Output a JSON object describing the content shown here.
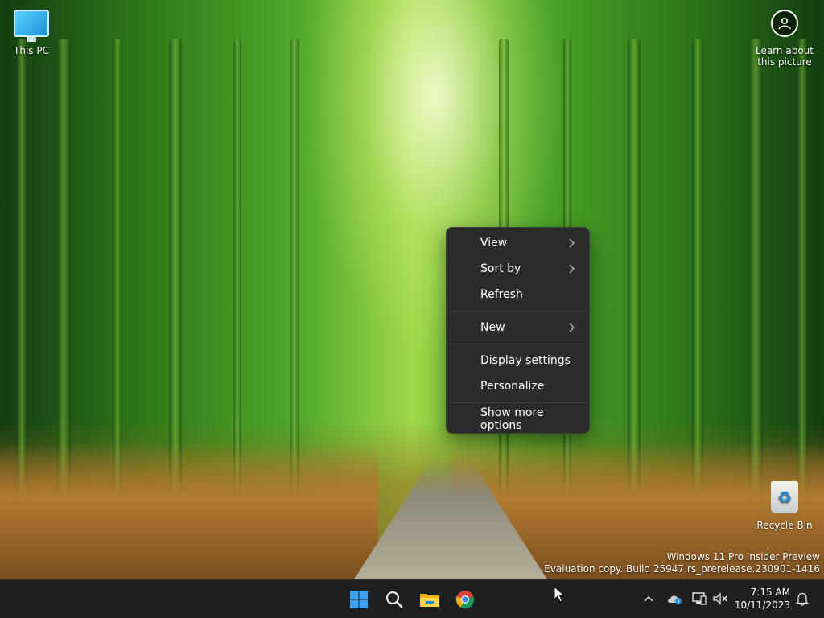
{
  "desktop": {
    "icons": {
      "this_pc": "This PC",
      "learn_about": "Learn about this picture",
      "recycle_bin": "Recycle Bin"
    },
    "watermark": {
      "line1": "Windows 11 Pro Insider Preview",
      "line2": "Evaluation copy. Build 25947.rs_prerelease.230901-1416"
    }
  },
  "context_menu": {
    "items": [
      {
        "label": "View",
        "has_submenu": true
      },
      {
        "label": "Sort by",
        "has_submenu": true
      },
      {
        "label": "Refresh",
        "has_submenu": false
      },
      {
        "label": "New",
        "has_submenu": true
      },
      {
        "label": "Display settings",
        "has_submenu": false
      },
      {
        "label": "Personalize",
        "has_submenu": false
      },
      {
        "label": "Show more options",
        "has_submenu": false
      }
    ]
  },
  "taskbar": {
    "pinned": [
      "start-icon",
      "search-icon",
      "file-explorer-icon",
      "chrome-icon"
    ],
    "tray_icons": [
      "chevron-up-icon",
      "onedrive-icon",
      "network-icon",
      "volume-muted-icon"
    ],
    "clock": {
      "time": "7:15 AM",
      "date": "10/11/2023"
    },
    "notification_icon": "bell-icon"
  },
  "colors": {
    "menu_bg": "#2b2b2b",
    "taskbar_bg": "#1f1f1f",
    "accent_blue": "#1a8fd8"
  }
}
